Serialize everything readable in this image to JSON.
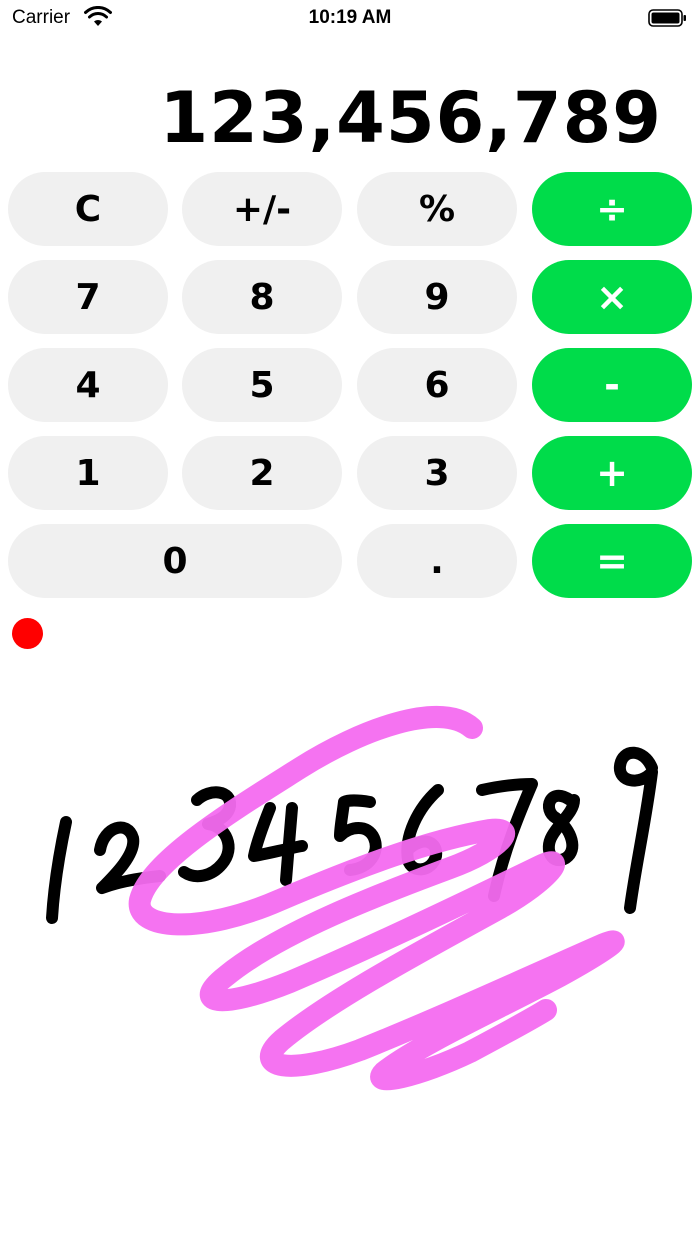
{
  "status": {
    "carrier": "Carrier",
    "time": "10:19 AM"
  },
  "display": {
    "value": "123,456,789"
  },
  "keys": {
    "clear": "C",
    "sign": "+/-",
    "percent": "%",
    "divide": "÷",
    "seven": "7",
    "eight": "8",
    "nine": "9",
    "multiply": "×",
    "four": "4",
    "five": "5",
    "six": "6",
    "minus": "-",
    "one": "1",
    "two": "2",
    "three": "3",
    "plus": "+",
    "zero": "0",
    "decimal": ".",
    "equals": "="
  },
  "colors": {
    "key_bg": "#f0f0f0",
    "operator_bg": "#00dc4a",
    "record_dot": "#ff0000",
    "ink": "#000000",
    "scribble": "#f46bf0"
  },
  "drawing": {
    "handwritten_content": "123456789",
    "has_scribble_overlay": true
  }
}
